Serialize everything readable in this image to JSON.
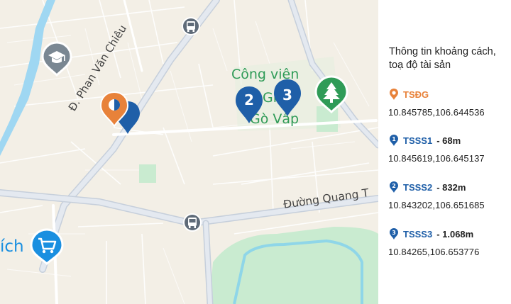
{
  "map": {
    "labels": {
      "street_phan_van_chieu": "Đ. Phan Văn Chiêu",
      "street_quang_trung": "Đường Quang T",
      "park_line1": "Công viên",
      "park_line2": "Gia",
      "park_line3": "Gò Vấp",
      "shop_partial": "ích"
    },
    "markers": {
      "tsdg": "",
      "tsss1": "",
      "tsss2": "2",
      "tsss3": "3"
    }
  },
  "panel": {
    "title": "Thông tin khoảng cách, toạ độ tài sản",
    "entries": [
      {
        "code": "TSĐG",
        "distance": "",
        "coords": "10.845785,106.644536",
        "color": "#e8823a",
        "pin_number": ""
      },
      {
        "code": "TSSS1",
        "distance": "- 68m",
        "coords": "10.845619,106.645137",
        "color": "#1f5fa8",
        "pin_number": "1"
      },
      {
        "code": "TSSS2",
        "distance": "- 832m",
        "coords": "10.843202,106.651685",
        "color": "#1f5fa8",
        "pin_number": "2"
      },
      {
        "code": "TSSS3",
        "distance": "- 1.068m",
        "coords": "10.84265,106.653776",
        "color": "#1f5fa8",
        "pin_number": "3"
      }
    ]
  },
  "colors": {
    "land": "#f3efe6",
    "road": "#ffffff",
    "major_road": "#b8c3d1",
    "water": "#9fd7f2",
    "park": "#c9ebd0",
    "park_label": "#2f9b57",
    "pin_primary": "#1f5fa8",
    "pin_subject": "#e8823a",
    "poi_gray": "#7a8792",
    "poi_blue": "#1a8fe0",
    "poi_green": "#2f9b57"
  },
  "icons": [
    "school-icon",
    "bus-stop-icon",
    "park-tree-icon",
    "shopping-cart-icon",
    "location-pin-icon"
  ]
}
